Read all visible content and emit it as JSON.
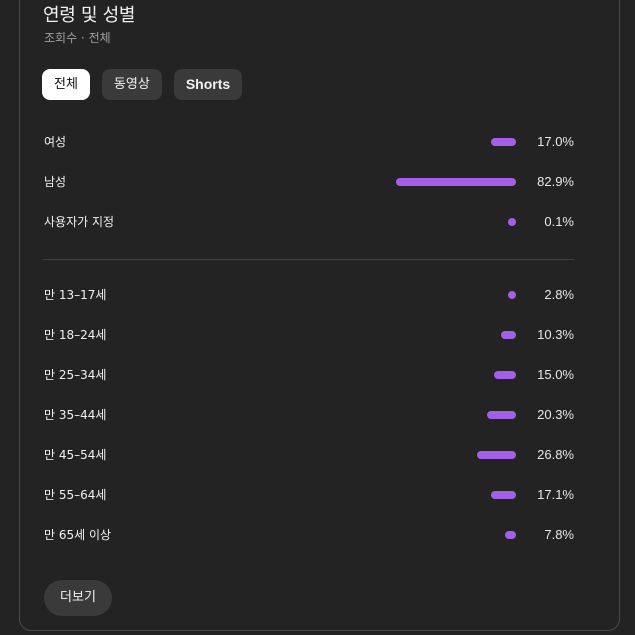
{
  "header": {
    "title": "연령 및 성별",
    "subtitle": "조회수 · 전체"
  },
  "tabs": [
    {
      "label": "전체",
      "active": true
    },
    {
      "label": "동영상",
      "active": false
    },
    {
      "label": "Shorts",
      "active": false
    }
  ],
  "colors": {
    "bar": "#a55ee8",
    "background": "#232323",
    "chip": "#3a3a3a"
  },
  "chart_data": [
    {
      "type": "bar",
      "title": "성별",
      "categories": [
        "여성",
        "남성",
        "사용자가 지정"
      ],
      "values": [
        17.0,
        82.9,
        0.1
      ],
      "value_labels": [
        "17.0%",
        "82.9%",
        "0.1%"
      ],
      "unit": "%"
    },
    {
      "type": "bar",
      "title": "연령",
      "categories": [
        "만 13–17세",
        "만 18–24세",
        "만 25–34세",
        "만 35–44세",
        "만 45–54세",
        "만 55–64세",
        "만 65세 이상"
      ],
      "values": [
        2.8,
        10.3,
        15.0,
        20.3,
        26.8,
        17.1,
        7.8
      ],
      "value_labels": [
        "2.8%",
        "10.3%",
        "15.0%",
        "20.3%",
        "26.8%",
        "17.1%",
        "7.8%"
      ],
      "unit": "%"
    }
  ],
  "footer": {
    "more_label": "더보기"
  }
}
